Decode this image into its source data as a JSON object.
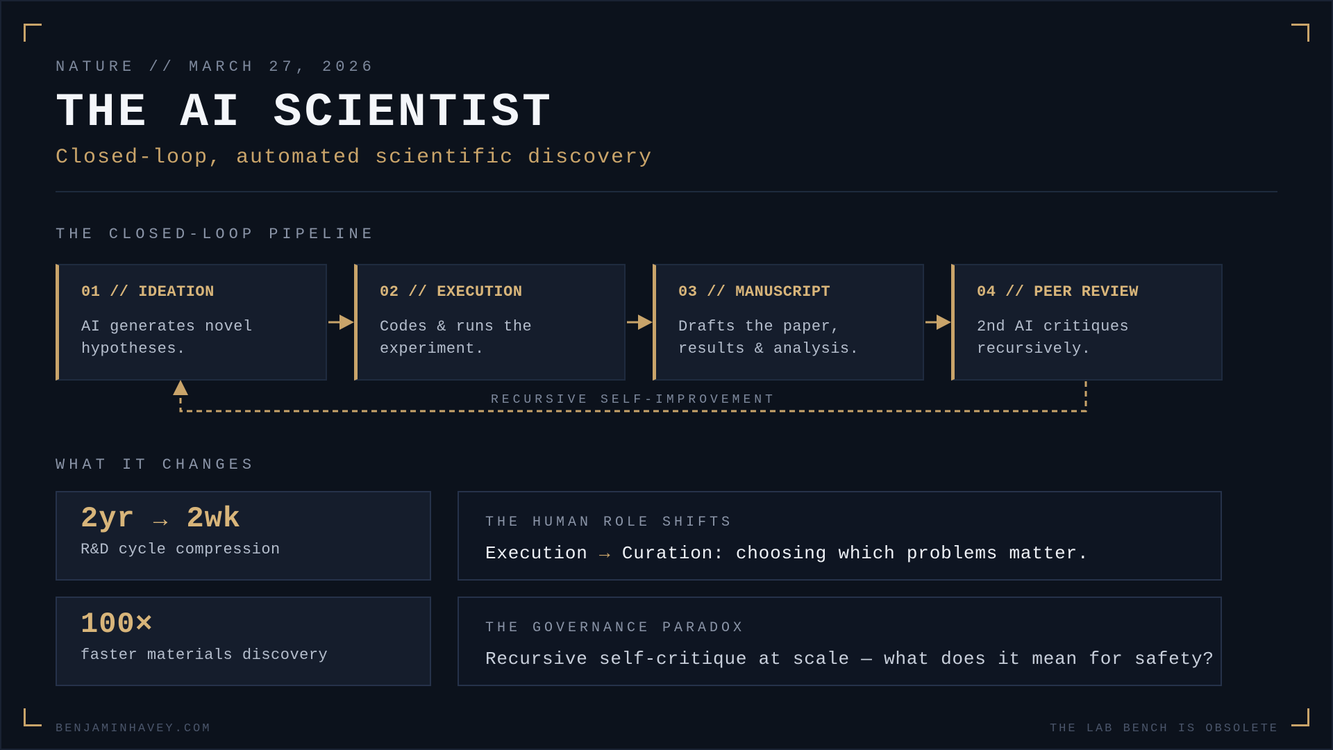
{
  "header": {
    "eyebrow": "NATURE // MARCH 27, 2026",
    "title": "THE AI SCIENTIST",
    "subtitle": "Closed-loop, automated scientific discovery"
  },
  "pipeline": {
    "label": "THE CLOSED-LOOP PIPELINE",
    "steps": [
      {
        "title": "01 // IDEATION",
        "description": "AI generates novel hypotheses."
      },
      {
        "title": "02 // EXECUTION",
        "description": "Codes & runs the experiment."
      },
      {
        "title": "03 // MANUSCRIPT",
        "description": "Drafts the paper, results & analysis."
      },
      {
        "title": "04 // PEER REVIEW",
        "description": "2nd AI critiques recursively."
      }
    ],
    "loop_label": "RECURSIVE SELF-IMPROVEMENT"
  },
  "changes": {
    "label": "WHAT IT CHANGES",
    "stats": [
      {
        "value_from": "2yr",
        "arrow": "→",
        "value_to": "2wk",
        "label": "R&D cycle compression"
      },
      {
        "value": "100×",
        "label": "faster materials discovery"
      }
    ],
    "notes": [
      {
        "label": "THE HUMAN ROLE SHIFTS",
        "text_a": "Execution",
        "arrow": "→",
        "text_b": "Curation: choosing which problems matter."
      },
      {
        "label": "THE GOVERNANCE PARADOX",
        "text": "Recursive self-critique at scale — what does it mean for safety?"
      }
    ]
  },
  "footer": {
    "left": "BENJAMINHAVEY.COM",
    "right": "THE LAB BENCH IS OBSOLETE"
  },
  "colors": {
    "background": "#0c121c",
    "accent": "#c9a46a",
    "card": "#151d2c"
  }
}
